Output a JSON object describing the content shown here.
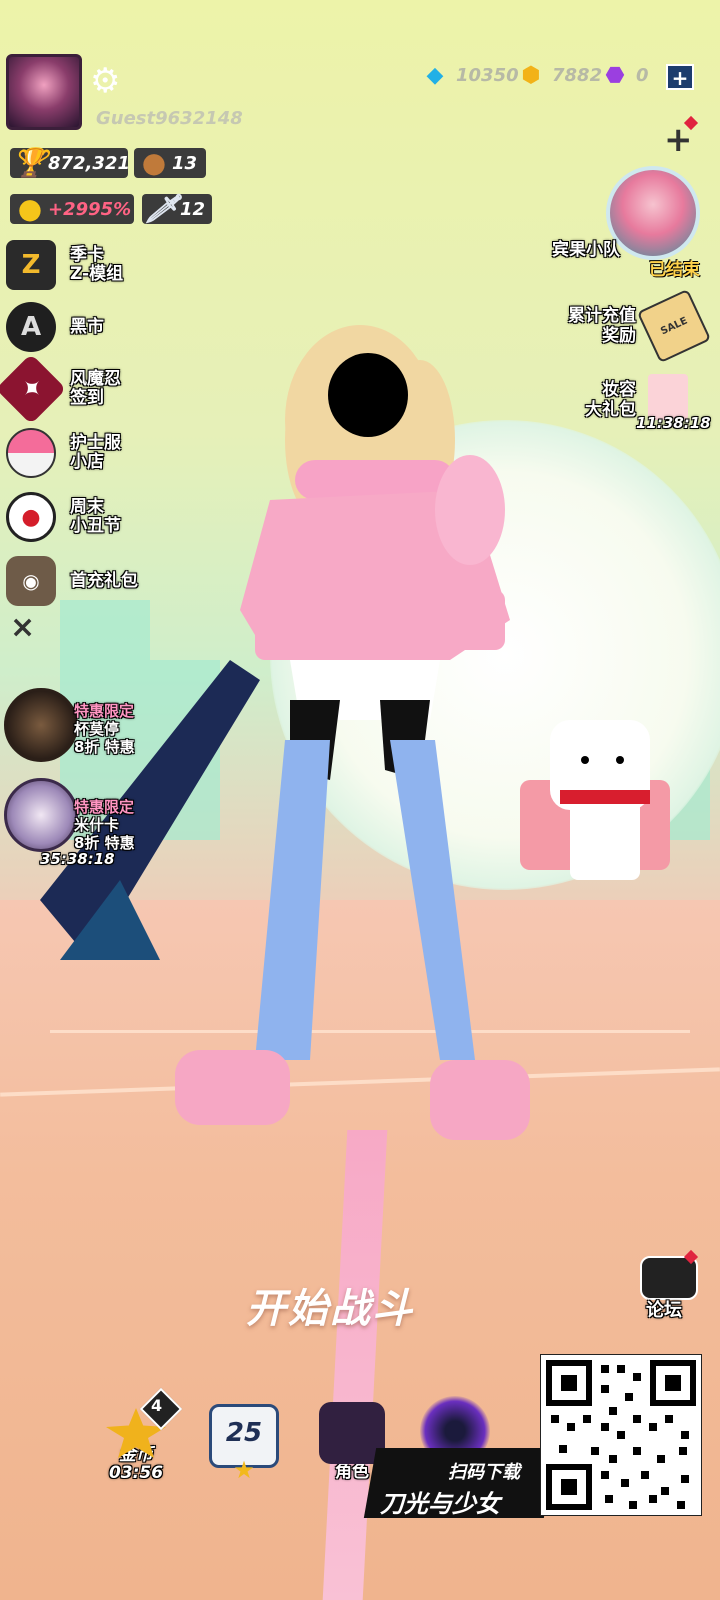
{
  "player": {
    "name": "Guest9632148"
  },
  "currencies": {
    "diamonds": "10350",
    "coins": "7882",
    "cubes": "0",
    "add_label": "+"
  },
  "stats": {
    "trophies": "872,321",
    "bears": "13",
    "boost": "+2995%",
    "swords": "12"
  },
  "left_menu": [
    {
      "label_line1": "季卡",
      "label_line2": "Z-模组",
      "icon_text": "Z"
    },
    {
      "label_line1": "黑市",
      "label_line2": "",
      "icon_text": "A"
    },
    {
      "label_line1": "风魔忍",
      "label_line2": "签到",
      "icon_text": "✦"
    },
    {
      "label_line1": "护士服",
      "label_line2": "小店",
      "icon_text": ""
    },
    {
      "label_line1": "周末",
      "label_line2": "小丑节",
      "icon_text": ""
    },
    {
      "label_line1": "首充礼包",
      "label_line2": "",
      "icon_text": ""
    }
  ],
  "left_close": "×",
  "promos": [
    {
      "line1": "特惠限定",
      "line2": "杯莫停",
      "line3": "8折 特惠"
    },
    {
      "line1": "特惠限定",
      "line2": "米什卡",
      "line3": "8折 特惠",
      "timer": "35:38:18"
    }
  ],
  "right_menu": {
    "team": {
      "label": "宾果小队",
      "status": "已结束"
    },
    "recharge": {
      "line1": "累计充值",
      "line2": "奖励",
      "tag": "SALE"
    },
    "makeup": {
      "line1": "妆容",
      "line2": "大礼包",
      "timer": "11:38:18"
    }
  },
  "forum": {
    "label": "论坛"
  },
  "start_battle": "开始战斗",
  "bottom_bar": {
    "coins": {
      "label": "金币",
      "timer": "03:56",
      "badge": "4"
    },
    "level": {
      "value": "25"
    },
    "role": {
      "label": "角色"
    }
  },
  "download": {
    "scan": "扫码下载",
    "title": "刀光与少女"
  },
  "colors": {
    "accent_pink": "#f08bb3",
    "red": "#e0243f",
    "sky": "#edf3a9",
    "floor": "#f3bd9c"
  }
}
